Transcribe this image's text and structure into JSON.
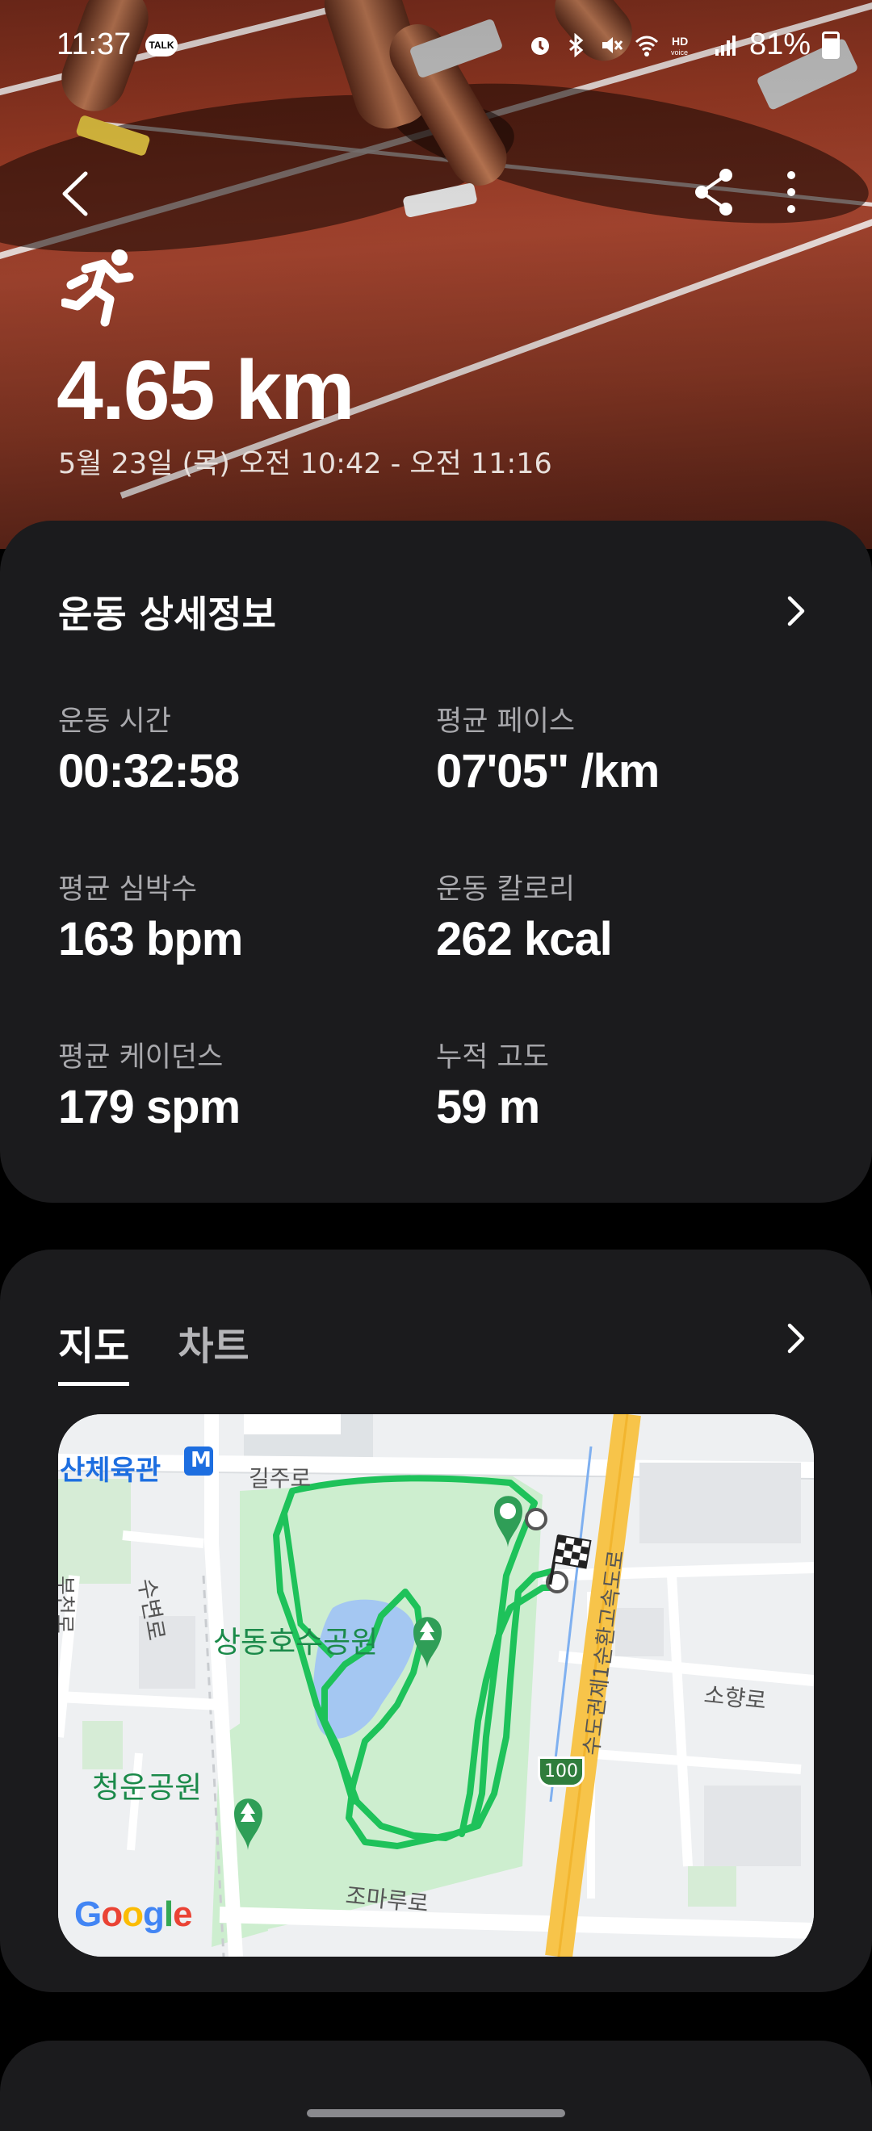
{
  "status_bar": {
    "time": "11:37",
    "talk_badge": "TALK",
    "battery": "81%"
  },
  "header": {
    "distance": "4.65 km",
    "date_range": "5월 23일 (목) 오전 10:42 - 오전 11:16"
  },
  "details": {
    "title": "운동 상세정보",
    "stats": [
      {
        "label": "운동 시간",
        "value": "00:32:58"
      },
      {
        "label": "평균 페이스",
        "value": "07'05\" /km"
      },
      {
        "label": "평균 심박수",
        "value": "163 bpm"
      },
      {
        "label": "운동 칼로리",
        "value": "262 kcal"
      },
      {
        "label": "평균 케이던스",
        "value": "179 spm"
      },
      {
        "label": "누적 고도",
        "value": "59 m"
      }
    ]
  },
  "map_section": {
    "tabs": [
      {
        "label": "지도",
        "active": true
      },
      {
        "label": "차트",
        "active": false
      }
    ],
    "labels": {
      "metro": "산체육관",
      "metro_badge": "M",
      "gilju": "길주로",
      "subyeon": "수변로",
      "bucheon": "부천로",
      "park_main": "상동호수공원",
      "park_cheongun": "청운공원",
      "ring_road": "수도권제1순환고속도로",
      "sohyang": "소향로",
      "joma": "조마루로",
      "route_shield": "100",
      "google": "Google"
    }
  },
  "colors": {
    "route": "#1ec25a",
    "card_bg": "#1b1b1d",
    "park_green": "#cdeecf",
    "water": "#a4c7f2",
    "highway": "#f7c44a"
  }
}
